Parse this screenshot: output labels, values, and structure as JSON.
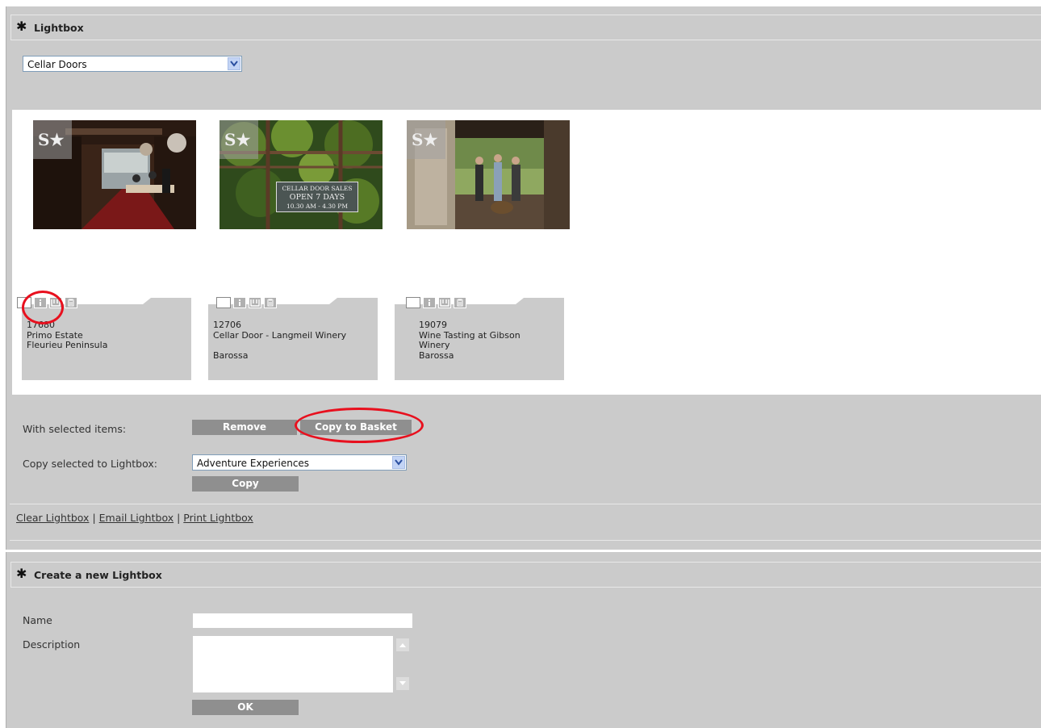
{
  "lightbox": {
    "header_title": "Lightbox",
    "selected_lightbox": "Cellar Doors",
    "items": [
      {
        "id": "17680",
        "line1": "Primo Estate",
        "line2": "Fleurieu Peninsula",
        "line3": ""
      },
      {
        "id": "12706",
        "line1": "Cellar Door - Langmeil Winery",
        "line2": "",
        "line3": "Barossa"
      },
      {
        "id": "19079",
        "line1": "Wine Tasting at Gibson",
        "line2": "Winery",
        "line3": "Barossa"
      }
    ],
    "watermark": "S★",
    "sign": {
      "line1": "CELLAR DOOR SALES",
      "line2": "OPEN 7 DAYS",
      "line3": "10.30 AM - 4.30 PM"
    },
    "with_selected_label": "With selected items:",
    "remove_label": "Remove",
    "copy_to_basket_label": "Copy to Basket",
    "copy_selected_label": "Copy selected to Lightbox:",
    "copy_target_value": "Adventure Experiences",
    "copy_label": "Copy",
    "links": {
      "clear": "Clear Lightbox",
      "email": "Email Lightbox",
      "print": "Print Lightbox",
      "separator": "|"
    }
  },
  "create": {
    "header_title": "Create a new Lightbox",
    "name_label": "Name",
    "description_label": "Description",
    "ok_label": "OK"
  },
  "icons": [
    "asterisk-icon",
    "chevron-down-icon",
    "checkbox-icon",
    "info-icon",
    "basket-icon",
    "trash-icon",
    "scroll-up-icon",
    "scroll-down-icon"
  ],
  "colors": {
    "panel": "#cbcbcb",
    "button": "#8f8f8f",
    "highlight": "#e8101e"
  }
}
